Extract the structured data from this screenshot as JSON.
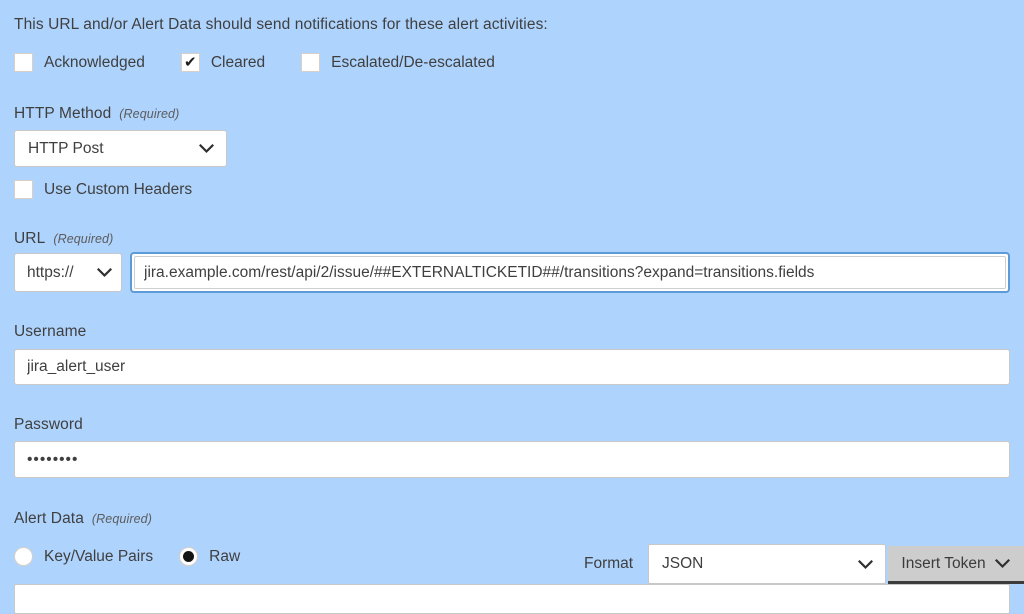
{
  "intro": {
    "text": "This URL and/or Alert Data should send notifications for these alert activities:"
  },
  "activities": {
    "items": [
      {
        "label": "Acknowledged",
        "checked": false
      },
      {
        "label": "Cleared",
        "checked": true
      },
      {
        "label": "Escalated/De-escalated",
        "checked": false
      }
    ]
  },
  "http_method": {
    "label": "HTTP Method",
    "required_tag": "(Required)",
    "value": "HTTP Post"
  },
  "custom_headers": {
    "label": "Use Custom Headers",
    "checked": false
  },
  "url": {
    "label": "URL",
    "required_tag": "(Required)",
    "scheme": "https://",
    "value": "jira.example.com/rest/api/2/issue/##EXTERNALTICKETID##/transitions?expand=transitions.fields"
  },
  "username": {
    "label": "Username",
    "value": "jira_alert_user"
  },
  "password": {
    "label": "Password",
    "value": "••••••••"
  },
  "alert_data": {
    "label": "Alert Data",
    "required_tag": "(Required)",
    "modes": [
      {
        "label": "Key/Value Pairs",
        "selected": false
      },
      {
        "label": "Raw",
        "selected": true
      }
    ],
    "format_label": "Format",
    "format_value": "JSON",
    "insert_token_label": "Insert Token",
    "body": ""
  },
  "icons": {
    "chevron_down": "chevron-down-icon",
    "check": "✔"
  },
  "colors": {
    "background": "#aed3fd",
    "focus_ring": "#5d9bd8",
    "text": "#3f3f3f",
    "button_gray": "#cdcdcd"
  }
}
